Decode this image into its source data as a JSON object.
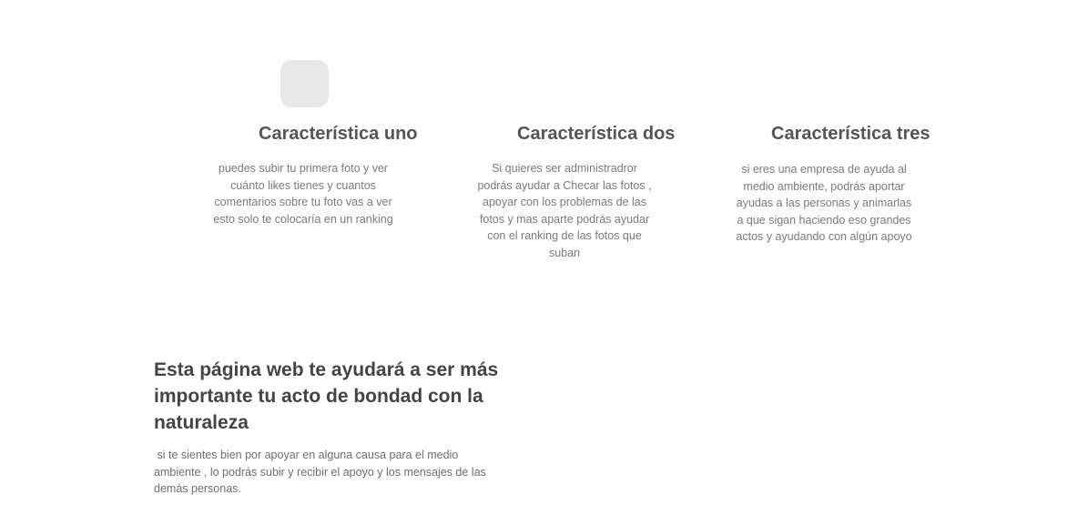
{
  "features": [
    {
      "icon": "placeholder-square-icon",
      "title": "Característica uno",
      "description": "puedes subir tu primera foto y ver cuánto likes tienes y cuantos comentarios sobre tu foto vas a ver esto solo te colocaría en un ranking"
    },
    {
      "title": "Característica dos",
      "description": "Si quieres ser administradror podrás ayudar a Checar las fotos , apoyar con los problemas de las fotos y mas aparte podrás ayudar con el ranking de las fotos que suban"
    },
    {
      "title": "Característica tres",
      "description": "si eres una empresa de ayuda al medio ambiente, podrás aportar ayudas a las personas y animarlas a que sigan haciendo eso grandes actos y ayudando con algún apoyo"
    }
  ],
  "promo": {
    "heading": "Esta página web te ayudará a ser más importante tu acto de bondad con la naturaleza",
    "text": " si te sientes bien por apoyar en alguna causa para el medio ambiente , lo podrás subir y recibir el apoyo y los mensajes de las demás personas."
  },
  "colors": {
    "icon_background": "#e8e8e8",
    "title": "#555555",
    "body_text": "#7a7a7a",
    "heading": "#444444"
  }
}
